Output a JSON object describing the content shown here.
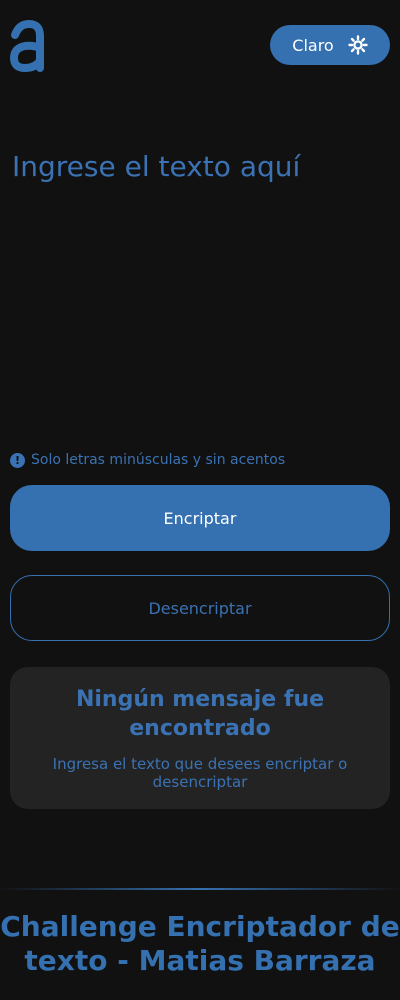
{
  "colors": {
    "background": "#111111",
    "accent": "#3570b0",
    "accent_text": "#3b72b3",
    "card": "#232323",
    "button_text": "#ffffff"
  },
  "header": {
    "logo_icon": "letter-a-logo",
    "theme_toggle": {
      "label": "Claro",
      "icon": "sun-icon"
    }
  },
  "editor": {
    "placeholder": "Ingrese el texto aquí",
    "value": ""
  },
  "hint": {
    "icon": "exclamation-circle-icon",
    "text": "Solo letras minúsculas y sin acentos"
  },
  "actions": {
    "encrypt_label": "Encriptar",
    "decrypt_label": "Desencriptar"
  },
  "result": {
    "title": "Ningún mensaje fue encontrado",
    "subtitle": "Ingresa el texto que desees encriptar o desencriptar"
  },
  "footer": {
    "text": "Challenge Encriptador de texto - Matias Barraza"
  }
}
